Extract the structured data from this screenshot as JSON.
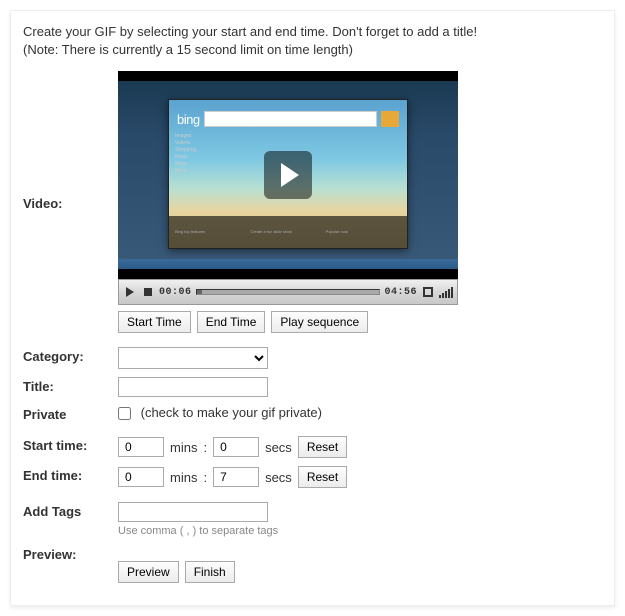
{
  "instructions": {
    "line1": "Create your GIF by selecting your start and end time. Don't forget to add a title!",
    "line2": "(Note: There is currently a 15 second limit on time length)"
  },
  "labels": {
    "video": "Video:",
    "category": "Category:",
    "title": "Title:",
    "private": "Private",
    "start_time": "Start time:",
    "end_time": "End time:",
    "add_tags": "Add Tags",
    "preview": "Preview:"
  },
  "video": {
    "current_time": "00:06",
    "total_time": "04:56",
    "thumbnail_brand": "bing"
  },
  "buttons": {
    "start_time": "Start Time",
    "end_time": "End Time",
    "play_sequence": "Play sequence",
    "reset": "Reset",
    "preview": "Preview",
    "finish": "Finish"
  },
  "fields": {
    "category_value": "",
    "title_value": "",
    "private_checked": false,
    "private_hint": "(check to make your gif private)",
    "start_mins": "0",
    "start_secs": "0",
    "end_mins": "0",
    "end_secs": "7",
    "mins_label": "mins",
    "secs_label": "secs",
    "colon": ":",
    "tags_value": "",
    "tags_hint": "Use comma ( , ) to separate tags"
  }
}
